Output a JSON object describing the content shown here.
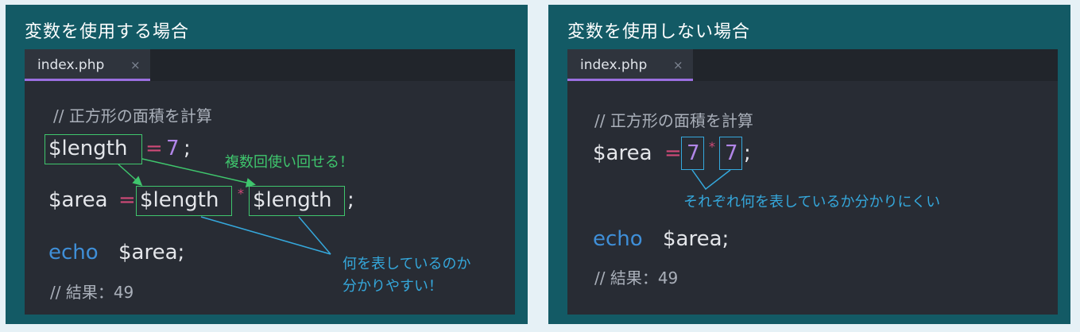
{
  "left": {
    "title": "変数を使用する場合",
    "tab": {
      "label": "index.php",
      "close": "×"
    },
    "code": {
      "comment1": "// 正方形の面積を計算",
      "line1_var": "$length",
      "line1_eq": "=",
      "line1_num": "7",
      "line1_semi": ";",
      "line2_var": "$area",
      "line2_eq": "=",
      "line2_a": "$length",
      "line2_mul": "*",
      "line2_b": "$length",
      "line2_semi": ";",
      "echo_kw": "echo",
      "echo_var": "$area;",
      "comment2": "// 結果：49"
    },
    "notes": {
      "reuse": "複数回使い回せる！",
      "clear_line1": "何を表しているのか",
      "clear_line2": "分かりやすい！"
    }
  },
  "right": {
    "title": "変数を使用しない場合",
    "tab": {
      "label": "index.php",
      "close": "×"
    },
    "code": {
      "comment1": "// 正方形の面積を計算",
      "line1_var": "$area",
      "line1_eq": "=",
      "line1_a": "7",
      "line1_mul": "*",
      "line1_b": "7",
      "line1_semi": ";",
      "echo_kw": "echo",
      "echo_var": "$area;",
      "comment2": "// 結果：49"
    },
    "notes": {
      "unclear": "それぞれ何を表しているか分かりにくい"
    }
  },
  "colors": {
    "panel": "#135a65",
    "editor": "#282c34",
    "green_annotation": "#3fc66d",
    "blue_annotation": "#35a8dc",
    "operator": "#d04a78",
    "number": "#b186e8",
    "keyword": "#3f8fd8"
  }
}
